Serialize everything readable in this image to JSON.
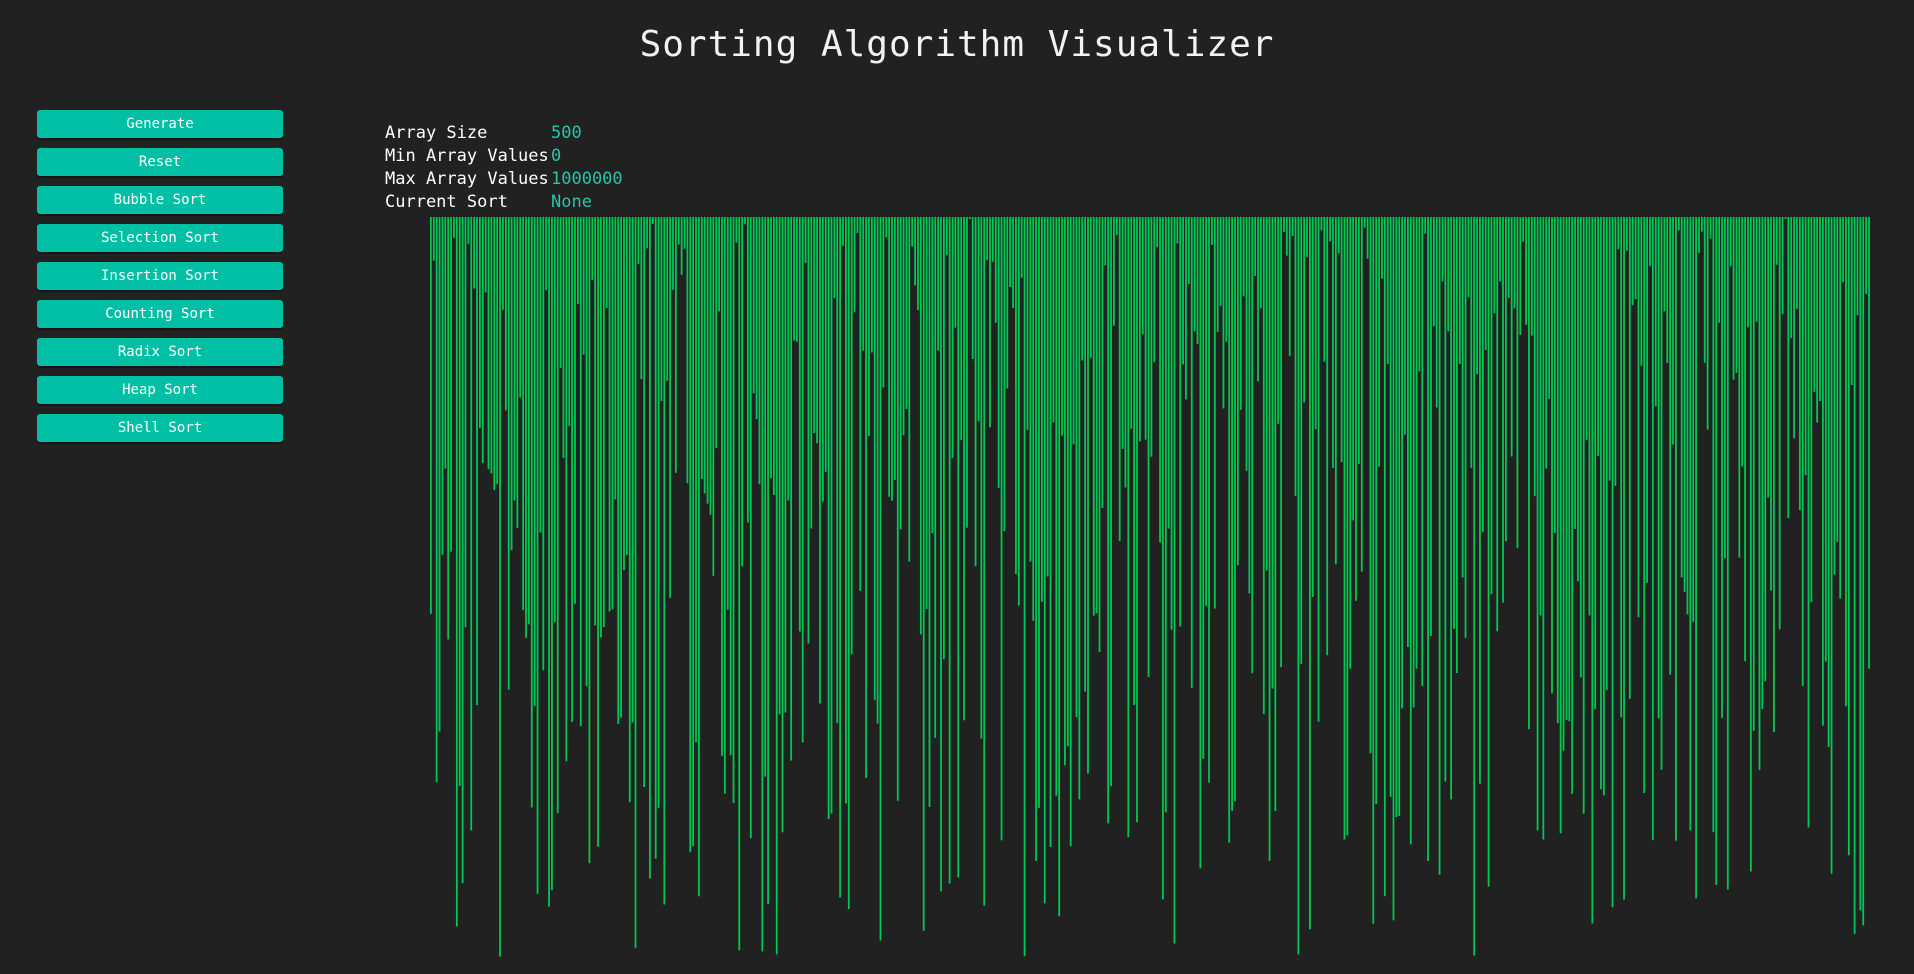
{
  "header": {
    "title": "Sorting Algorithm Visualizer"
  },
  "sidebar": {
    "buttons": [
      {
        "label": "Generate"
      },
      {
        "label": "Reset"
      },
      {
        "label": "Bubble Sort"
      },
      {
        "label": "Selection Sort"
      },
      {
        "label": "Insertion Sort"
      },
      {
        "label": "Counting Sort"
      },
      {
        "label": "Radix Sort"
      },
      {
        "label": "Heap Sort"
      },
      {
        "label": "Shell Sort"
      }
    ]
  },
  "info": {
    "array_size_label": "Array Size",
    "array_size_value": "500",
    "min_label": "Min Array Values",
    "min_value": "0",
    "max_label": "Max Array Values",
    "max_value": "1000000",
    "current_sort_label": "Current Sort",
    "current_sort_value": "None"
  },
  "colors": {
    "background": "#212121",
    "button": "#00bfa5",
    "value_text": "#26c6a6",
    "bar": "#00c853"
  },
  "visualizer": {
    "array_size": 500,
    "max_value": 1000000
  }
}
